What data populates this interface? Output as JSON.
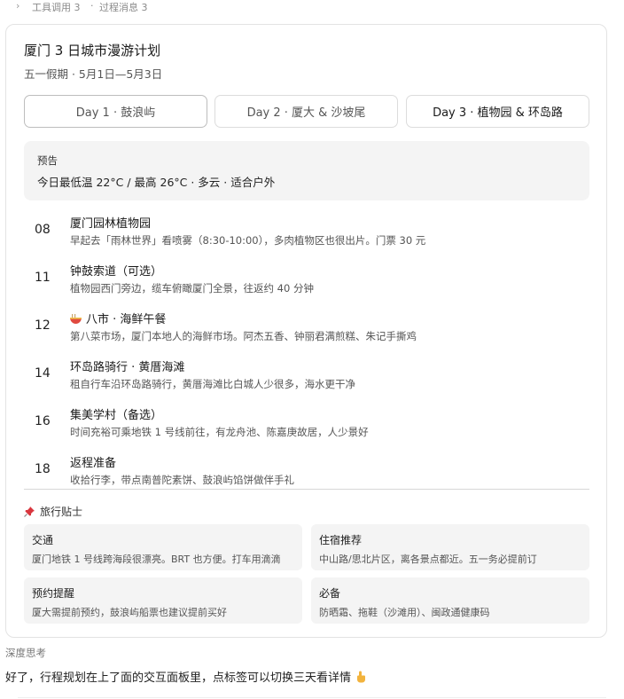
{
  "topbar": {
    "tool_calls": "工具调用 3",
    "separator": "·",
    "process_messages": "过程消息 3"
  },
  "plan": {
    "title": "厦门 3 日城市漫游计划",
    "subtitle": "五一假期 · 5月1日—5月3日",
    "tabs": [
      {
        "label": "Day 1 · 鼓浪屿",
        "selected": false
      },
      {
        "label": "Day 2 · 厦大 & 沙坡尾",
        "selected": false
      },
      {
        "label": "Day 3 · 植物园 & 环岛路",
        "selected": true
      }
    ],
    "forecast": {
      "label": "预告",
      "text": "今日最低温 22°C / 最高 26°C · 多云 · 适合户外"
    },
    "itinerary": [
      {
        "time": "08",
        "name": "厦门园林植物园",
        "desc": "早起去「雨林世界」看喷雾（8:30-10:00），多肉植物区也很出片。门票 30 元"
      },
      {
        "time": "11",
        "name": "钟鼓索道（可选）",
        "desc": "植物园西门旁边，缆车俯瞰厦门全景，往返约 40 分钟"
      },
      {
        "time": "12",
        "name": "八市 · 海鲜午餐",
        "icon": "noodle-bowl-icon",
        "desc": "第八菜市场，厦门本地人的海鲜市场。阿杰五香、钟丽君满煎糕、朱记手撕鸡"
      },
      {
        "time": "14",
        "name": "环岛路骑行 · 黄厝海滩",
        "desc": "租自行车沿环岛路骑行，黄厝海滩比白城人少很多，海水更干净"
      },
      {
        "time": "16",
        "name": "集美学村（备选）",
        "desc": "时间充裕可乘地铁 1 号线前往，有龙舟池、陈嘉庚故居，人少景好"
      },
      {
        "time": "18",
        "name": "返程准备",
        "desc": "收拾行李，带点南普陀素饼、鼓浪屿馅饼做伴手礼"
      }
    ],
    "tips": {
      "heading": "旅行贴士",
      "items": [
        {
          "title": "交通",
          "text": "厦门地铁 1 号线跨海段很漂亮。BRT 也方便。打车用滴滴"
        },
        {
          "title": "住宿推荐",
          "text": "中山路/思北片区，离各景点都近。五一务必提前订"
        },
        {
          "title": "预约提醒",
          "text": "厦大需提前预约，鼓浪屿船票也建议提前买好"
        },
        {
          "title": "必备",
          "text": "防晒霜、拖鞋（沙滩用）、闽政通健康码"
        }
      ]
    }
  },
  "thinking_label": "深度思考",
  "reply_text": "好了，行程规划在上了面的交互面板里，点标签可以切换三天看详情",
  "colors": {
    "card_border": "#e3e3e3",
    "panel_bg": "#f4f4f4",
    "pin_red": "#d9363e"
  }
}
